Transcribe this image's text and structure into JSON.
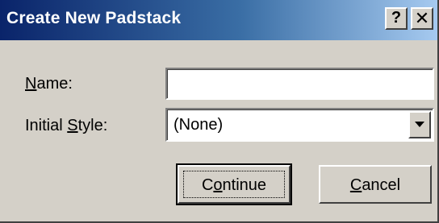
{
  "dialog": {
    "title": "Create New Padstack",
    "help_label": "?",
    "close_label": "✕"
  },
  "form": {
    "name": {
      "label_mnemonic": "N",
      "label_rest": "ame:",
      "value": ""
    },
    "initial_style": {
      "label_prefix": "Initial ",
      "label_mnemonic": "S",
      "label_rest": "tyle:",
      "selected": "(None)"
    }
  },
  "buttons": {
    "continue": {
      "pre": "C",
      "mnemonic": "o",
      "post": "ntinue"
    },
    "cancel": {
      "mnemonic": "C",
      "post": "ancel"
    }
  },
  "colors": {
    "titlebar_start": "#0a246a",
    "titlebar_end": "#a6caf0",
    "face": "#d4d0c8"
  }
}
